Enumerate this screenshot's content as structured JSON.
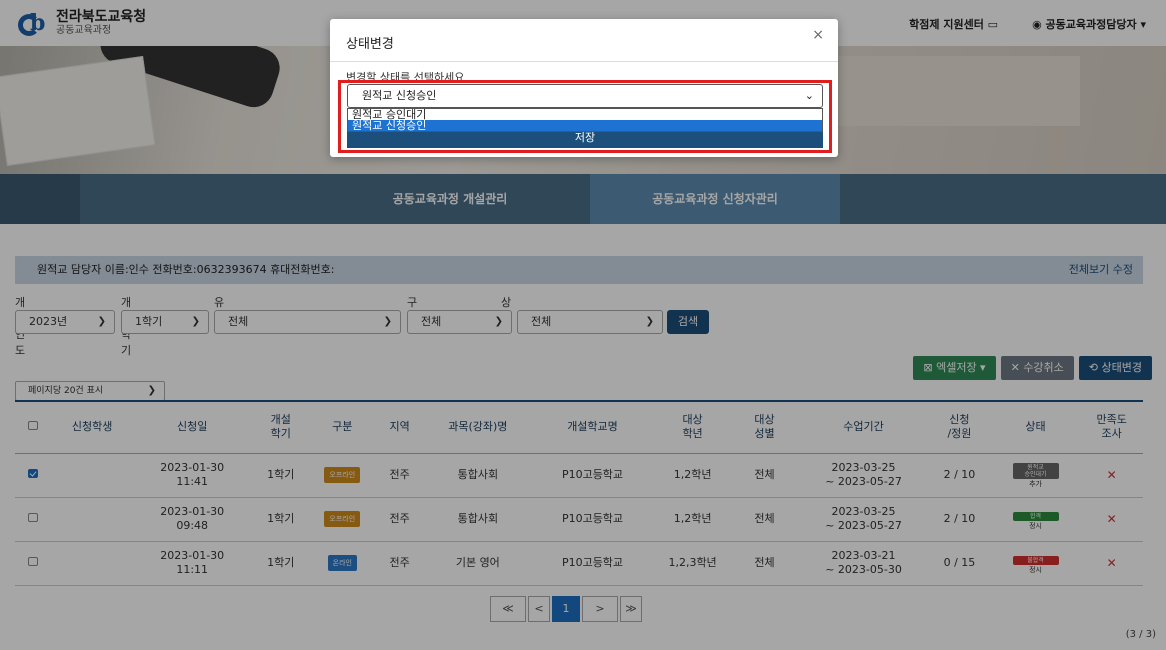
{
  "header": {
    "logo_title": "전라북도교육청",
    "logo_sub": "공동교육과정",
    "support_center": "학점제 지원센터",
    "user_menu": "공동교육과정담당자"
  },
  "tabs": [
    "공동교육과정 개설관리",
    "공동교육과정 신청자관리"
  ],
  "infobar": {
    "text": "원적교 담당자  이름:인수  전화번호:0632393674  휴대전화번호:",
    "right": "전체보기 수정"
  },
  "filters": {
    "labels": [
      "개설연도",
      "개설학기",
      "유형",
      "구분",
      "상태"
    ],
    "year": "2023년",
    "semester": "1학기",
    "type": "전체",
    "category": "전체",
    "status": "전체",
    "search": "검색"
  },
  "actions": {
    "excel": "엑셀저장",
    "cancel": "수강취소",
    "status_change": "상태변경"
  },
  "perpage": "페이지당 20건 표시",
  "table": {
    "headers": [
      "",
      "신청학생",
      "신청일",
      "개설\n학기",
      "구분",
      "지역",
      "과목(강좌)명",
      "개설학교명",
      "대상\n학년",
      "대상\n성별",
      "수업기간",
      "신청\n/정원",
      "상태",
      "만족도\n조사"
    ],
    "rows": [
      {
        "checked": true,
        "student": "",
        "date": "2023-01-30",
        "time": "11:41",
        "semester": "1학기",
        "badge": "오프라인",
        "region": "전주",
        "subject": "통합사회",
        "school": "P10고등학교",
        "grade": "1,2학년",
        "gender": "전체",
        "period_start": "2023-03-25",
        "period_end": "~ 2023-05-27",
        "count": "2 / 10",
        "status_line1": "원적교",
        "status_line2": "승인대기",
        "status_sub": "추가"
      },
      {
        "checked": false,
        "student": "",
        "date": "2023-01-30",
        "time": "09:48",
        "semester": "1학기",
        "badge": "오프라인",
        "region": "전주",
        "subject": "통합사회",
        "school": "P10고등학교",
        "grade": "1,2학년",
        "gender": "전체",
        "period_start": "2023-03-25",
        "period_end": "~ 2023-05-27",
        "count": "2 / 10",
        "status_line1": "합격",
        "status_line2": "",
        "status_sub": "정시"
      },
      {
        "checked": false,
        "student": "",
        "date": "2023-01-30",
        "time": "11:11",
        "semester": "1학기",
        "badge": "온라인",
        "region": "전주",
        "subject": "기본 영어",
        "school": "P10고등학교",
        "grade": "1,2,3학년",
        "gender": "전체",
        "period_start": "2023-03-21",
        "period_end": "~ 2023-05-30",
        "count": "0 / 15",
        "status_line1": "불합격",
        "status_line2": "",
        "status_sub": "정시"
      }
    ]
  },
  "pager": {
    "first": "≪",
    "prev": "<",
    "current": "1",
    "next": ">",
    "last": "≫"
  },
  "count": "(3 / 3)",
  "modal": {
    "title": "상태변경",
    "close": "×",
    "label": "변경할 상태를 선택하세요",
    "selected": "원적교 신청승인",
    "options": [
      "원적교 승인대기",
      "원적교 신청승인"
    ],
    "save": "저장"
  }
}
